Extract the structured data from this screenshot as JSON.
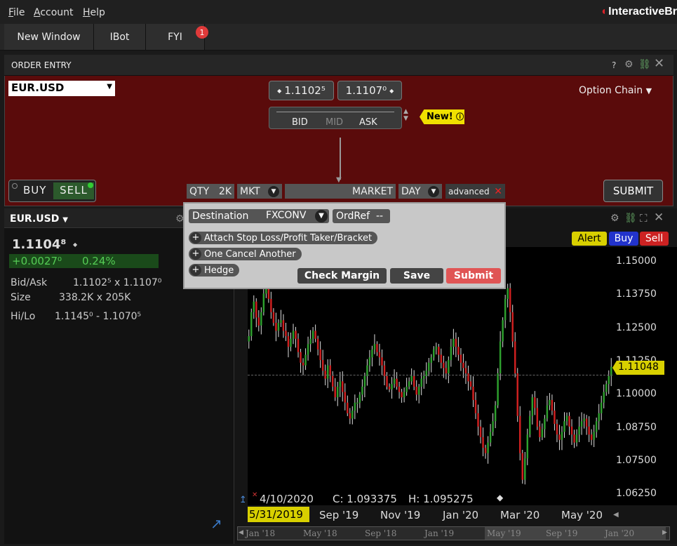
{
  "menu": {
    "file": "File",
    "account": "Account",
    "help": "Help",
    "brand": "InteractiveBr"
  },
  "tabs": {
    "new_window": "New Window",
    "ibot": "IBot",
    "fyi": "FYI",
    "fyi_badge": "1"
  },
  "order_entry": {
    "title": "ORDER ENTRY",
    "help": "?",
    "symbol": "EUR.USD",
    "bid_price": "1.1102⁵",
    "ask_price": "1.1107⁰",
    "bid_label": "BID",
    "mid_label": "MID",
    "ask_label": "ASK",
    "option_chain": "Option Chain",
    "new_badge": "New!",
    "buy": "BUY",
    "sell": "SELL",
    "qty_label": "QTY",
    "qty_value": "2K",
    "order_type": "MKT",
    "price_text": "MARKET",
    "tif": "DAY",
    "advanced": "advanced",
    "submit": "SUBMIT"
  },
  "advanced_popup": {
    "destination_label": "Destination",
    "destination_value": "FXCONV",
    "ordref_label": "OrdRef",
    "ordref_value": "--",
    "attach": "Attach Stop Loss/Profit Taker/Bracket",
    "oca": "One Cancel Another",
    "hedge": "Hedge",
    "check_margin": "Check Margin",
    "save": "Save",
    "submit": "Submit"
  },
  "quote": {
    "symbol": "EUR.USD",
    "last": "1.1104⁸",
    "change": "+0.0027⁰",
    "change_pct": "0.24%",
    "bidask_label": "Bid/Ask",
    "bidask_value": "1.1102⁵ x 1.1107⁰",
    "size_label": "Size",
    "size_value": "338.2K x 205K",
    "hilo_label": "Hi/Lo",
    "hilo_value": "1.1145⁰ - 1.1070⁵"
  },
  "chart_buttons": {
    "alert": "Alert",
    "buy": "Buy",
    "sell": "Sell"
  },
  "chart_info": {
    "date": "4/10/2020",
    "close": "C: 1.093375",
    "high": "H: 1.095275",
    "start_date": "5/31/2019",
    "last_tag": "1.11048"
  },
  "colors": {
    "up": "#2ea02e",
    "down": "#d02020",
    "accent": "#f0e000",
    "order_bg": "#5a0b0b"
  },
  "chart_data": {
    "type": "candlestick",
    "yticks": [
      "1.15000",
      "1.13750",
      "1.12500",
      "1.11250",
      "1.10000",
      "1.08750",
      "1.07500",
      "1.06250"
    ],
    "ylim": [
      1.0584,
      1.1555
    ],
    "xticks": [
      "Sep '19",
      "Nov '19",
      "Jan '20",
      "Mar '20",
      "May '20"
    ],
    "navigator_ticks": [
      "Jan '18",
      "May '18",
      "Sep '18",
      "Jan '19",
      "May '19",
      "Sep '19",
      "Jan '20"
    ],
    "last_value": 1.11048,
    "closes": [
      1.122,
      1.131,
      1.135,
      1.129,
      1.126,
      1.131,
      1.138,
      1.141,
      1.136,
      1.131,
      1.127,
      1.124,
      1.127,
      1.128,
      1.124,
      1.122,
      1.118,
      1.121,
      1.124,
      1.121,
      1.116,
      1.112,
      1.111,
      1.115,
      1.119,
      1.121,
      1.124,
      1.121,
      1.117,
      1.113,
      1.109,
      1.106,
      1.111,
      1.107,
      1.103,
      1.099,
      1.103,
      1.105,
      1.101,
      1.097,
      1.093,
      1.091,
      1.094,
      1.097,
      1.097,
      1.1,
      1.103,
      1.107,
      1.111,
      1.114,
      1.117,
      1.119,
      1.116,
      1.114,
      1.111,
      1.107,
      1.103,
      1.102,
      1.104,
      1.106,
      1.103,
      1.101,
      1.099,
      1.101,
      1.103,
      1.105,
      1.107,
      1.103,
      1.1,
      1.103,
      1.106,
      1.107,
      1.109,
      1.112,
      1.114,
      1.117,
      1.118,
      1.115,
      1.112,
      1.11,
      1.108,
      1.113,
      1.118,
      1.121,
      1.118,
      1.115,
      1.112,
      1.11,
      1.108,
      1.105,
      1.103,
      1.098,
      1.093,
      1.088,
      1.084,
      1.08,
      1.078,
      1.082,
      1.086,
      1.09,
      1.096,
      1.108,
      1.12,
      1.128,
      1.136,
      1.14,
      1.131,
      1.12,
      1.108,
      1.092,
      1.078,
      1.068,
      1.076,
      1.085,
      1.092,
      1.099,
      1.095,
      1.088,
      1.084,
      1.087,
      1.091,
      1.096,
      1.098,
      1.094,
      1.089,
      1.085,
      1.083,
      1.086,
      1.09,
      1.092,
      1.088,
      1.085,
      1.082,
      1.085,
      1.088,
      1.09,
      1.091,
      1.088,
      1.085,
      1.083,
      1.086,
      1.09,
      1.093,
      1.097,
      1.101,
      1.104,
      1.107,
      1.1105
    ]
  }
}
